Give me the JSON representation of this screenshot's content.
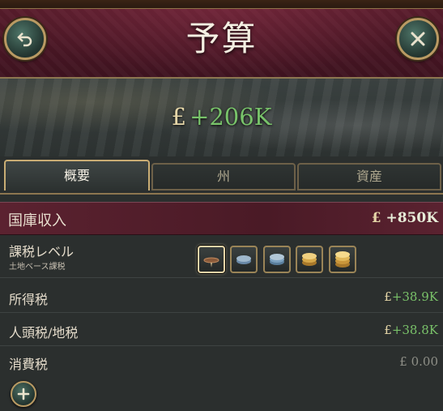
{
  "header": {
    "title": "予算",
    "back_icon": "back-arrow-icon",
    "close_icon": "close-icon"
  },
  "banner": {
    "currency": "£",
    "balance": "+206K"
  },
  "tabs": [
    {
      "label": "概要",
      "active": true
    },
    {
      "label": "州",
      "active": false
    },
    {
      "label": "資産",
      "active": false
    }
  ],
  "treasury": {
    "label": "国庫収入",
    "currency": "£",
    "value": "+850K"
  },
  "taxation": {
    "label": "課税レベル",
    "sublabel": "土地ベース課税",
    "levels": [
      {
        "icon": "tax-level-1-icon",
        "selected": true
      },
      {
        "icon": "tax-level-2-icon",
        "selected": false
      },
      {
        "icon": "tax-level-3-icon",
        "selected": false
      },
      {
        "icon": "tax-level-4-icon",
        "selected": false
      },
      {
        "icon": "tax-level-5-icon",
        "selected": false
      }
    ]
  },
  "rows": [
    {
      "label": "所得税",
      "currency": "£",
      "value": "+38.9K"
    },
    {
      "label": "人頭税/地税",
      "currency": "£",
      "value": "+38.8K"
    },
    {
      "label": "消費税",
      "currency": "£",
      "value": "0.00"
    }
  ],
  "add_icon": "plus-icon",
  "colors": {
    "positive": "#78c36a",
    "header": "#5a1d2c",
    "gold_border": "#b99a63",
    "panel": "#2b2f2e"
  }
}
